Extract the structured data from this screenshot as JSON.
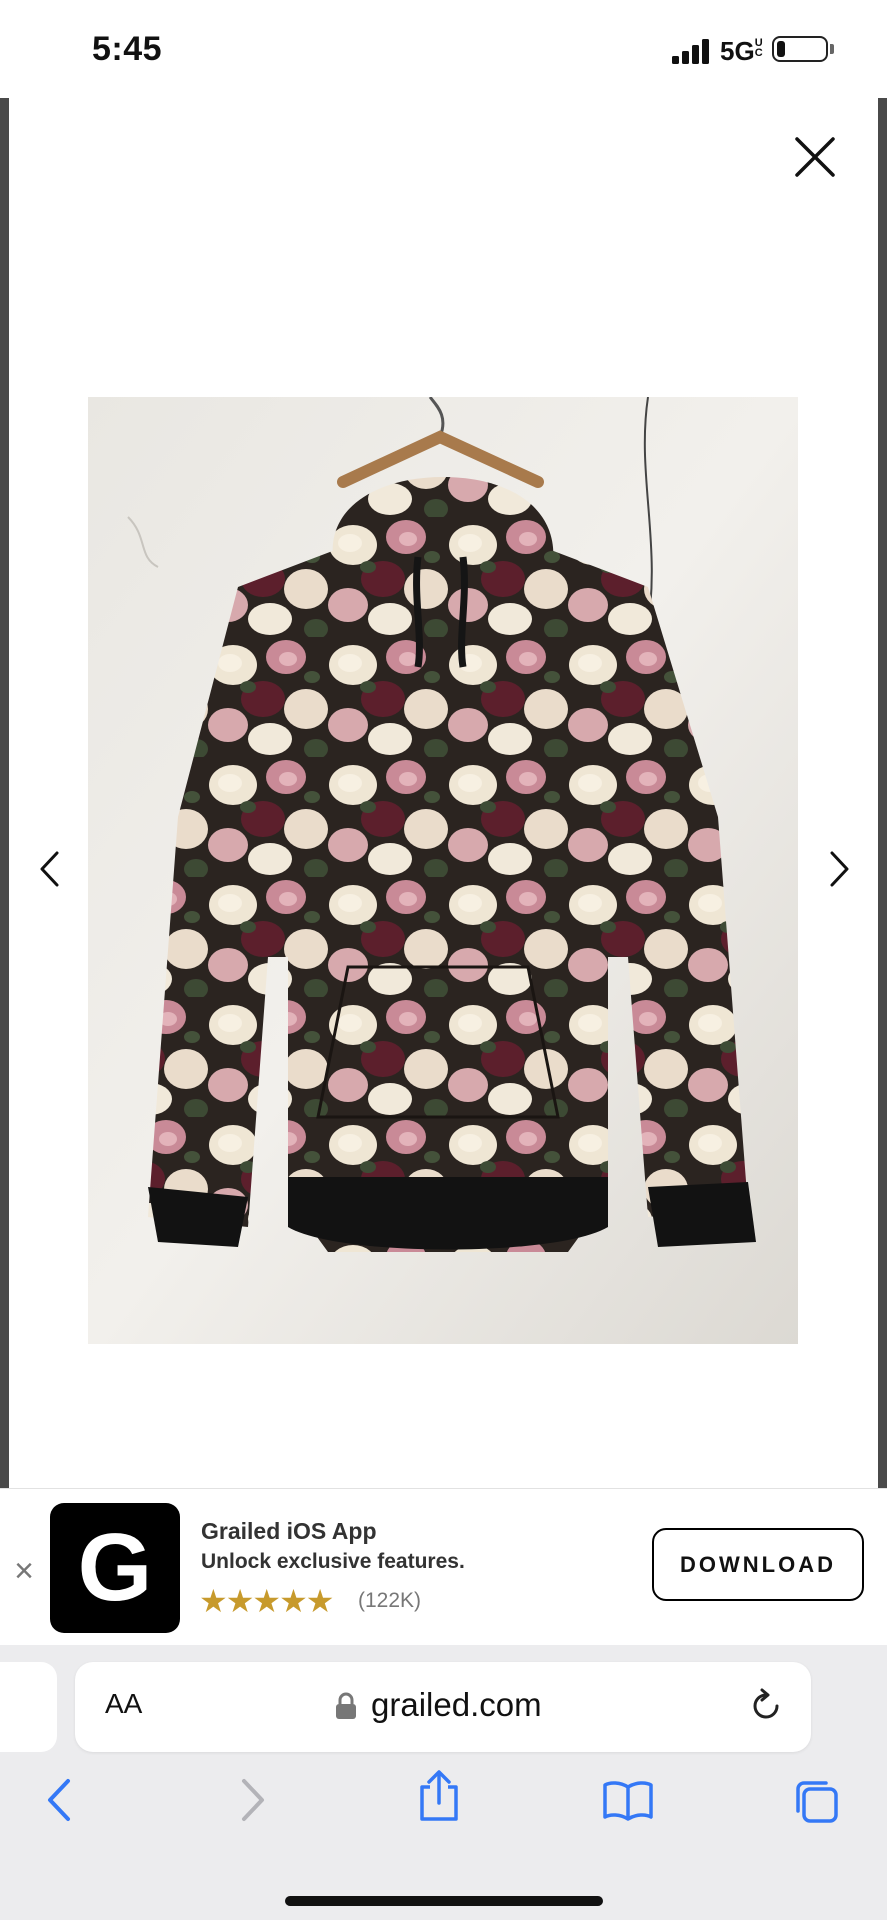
{
  "status_bar": {
    "time": "5:45",
    "network": "5G",
    "network_suffix": "UC"
  },
  "lightbox": {
    "close_icon": "close-icon",
    "prev_icon": "chevron-left-icon",
    "next_icon": "chevron-right-icon",
    "image": "floral-hoodie-photo"
  },
  "app_banner": {
    "app_name": "Grailed iOS App",
    "subtitle": "Unlock exclusive features.",
    "icon_letter": "G",
    "stars": "★★★★★",
    "rating_count": "(122K)",
    "download_label": "DOWNLOAD",
    "star_color": "#c79a2c"
  },
  "browser": {
    "text_size_label": "AA",
    "url": "grailed.com",
    "icons": [
      "back-icon",
      "forward-icon",
      "share-icon",
      "bookmarks-icon",
      "tabs-icon"
    ],
    "accent_color": "#3478f6"
  }
}
